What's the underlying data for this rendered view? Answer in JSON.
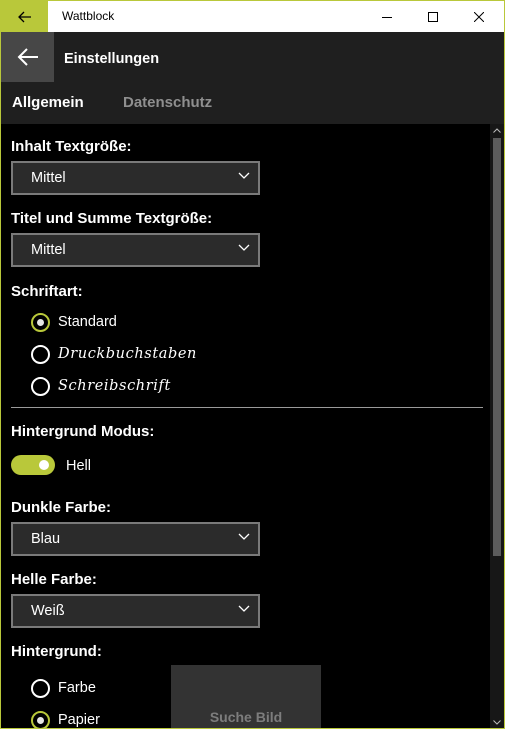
{
  "window": {
    "title": "Wattblock",
    "accent": "#b9c83a"
  },
  "header": {
    "page_title": "Einstellungen",
    "back_icon": "arrow-left-icon",
    "tabs": [
      {
        "label": "Allgemein",
        "active": true
      },
      {
        "label": "Datenschutz",
        "active": false
      }
    ]
  },
  "settings": {
    "content_font_size": {
      "label": "Inhalt Textgröße:",
      "value": "Mittel"
    },
    "title_font_size": {
      "label": "Titel und Summe Textgröße:",
      "value": "Mittel"
    },
    "font": {
      "label": "Schriftart:",
      "options": [
        {
          "label": "Standard",
          "checked": true
        },
        {
          "label": "Druckbuchstaben",
          "checked": false
        },
        {
          "label": "Schreibschrift",
          "checked": false
        }
      ]
    },
    "background_mode": {
      "label": "Hintergrund Modus:",
      "toggle_on": true,
      "toggle_text": "Hell"
    },
    "dark_color": {
      "label": "Dunkle Farbe:",
      "value": "Blau"
    },
    "light_color": {
      "label": "Helle Farbe:",
      "value": "Weiß"
    },
    "background": {
      "label": "Hintergrund:",
      "options": [
        {
          "label": "Farbe",
          "checked": false
        },
        {
          "label": "Papier",
          "checked": true
        }
      ],
      "search_button": "Suche Bild"
    }
  }
}
